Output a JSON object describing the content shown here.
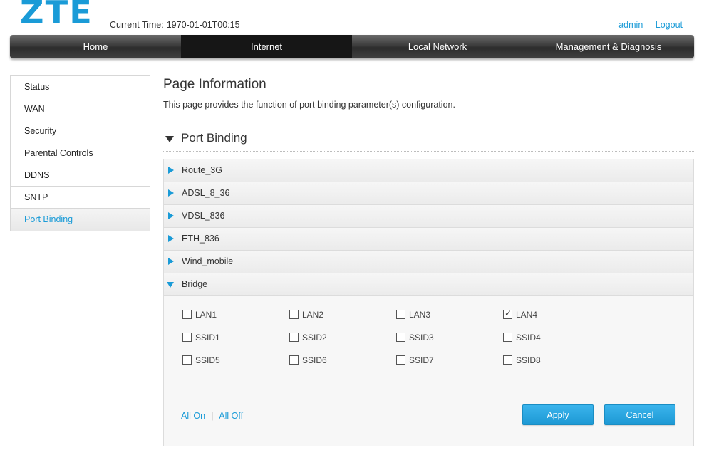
{
  "header": {
    "logo": "ZTE",
    "time_label": "Current Time:",
    "time_value": "1970-01-01T00:15",
    "user": "admin",
    "logout": "Logout"
  },
  "topnav": {
    "tabs": [
      {
        "label": "Home",
        "active": false
      },
      {
        "label": "Internet",
        "active": true
      },
      {
        "label": "Local Network",
        "active": false
      },
      {
        "label": "Management & Diagnosis",
        "active": false
      }
    ]
  },
  "sidenav": {
    "items": [
      {
        "label": "Status"
      },
      {
        "label": "WAN"
      },
      {
        "label": "Security"
      },
      {
        "label": "Parental Controls"
      },
      {
        "label": "DDNS"
      },
      {
        "label": "SNTP"
      },
      {
        "label": "Port Binding",
        "active": true
      }
    ]
  },
  "main": {
    "title": "Page Information",
    "description": "This page provides the function of port binding parameter(s) configuration.",
    "section_title": "Port Binding",
    "connections": [
      "Route_3G",
      "ADSL_8_36",
      "VDSL_836",
      "ETH_836",
      "Wind_mobile"
    ],
    "open_connection": "Bridge",
    "ports": [
      {
        "label": "LAN1",
        "checked": false
      },
      {
        "label": "LAN2",
        "checked": false
      },
      {
        "label": "LAN3",
        "checked": false
      },
      {
        "label": "LAN4",
        "checked": true
      },
      {
        "label": "SSID1",
        "checked": false
      },
      {
        "label": "SSID2",
        "checked": false
      },
      {
        "label": "SSID3",
        "checked": false
      },
      {
        "label": "SSID4",
        "checked": false
      },
      {
        "label": "SSID5",
        "checked": false
      },
      {
        "label": "SSID6",
        "checked": false
      },
      {
        "label": "SSID7",
        "checked": false
      },
      {
        "label": "SSID8",
        "checked": false
      }
    ],
    "all_on": "All On",
    "separator": "|",
    "all_off": "All Off",
    "apply": "Apply",
    "cancel": "Cancel"
  },
  "colors": {
    "accent": "#1a9bd7",
    "nav_dark": "#161616"
  }
}
